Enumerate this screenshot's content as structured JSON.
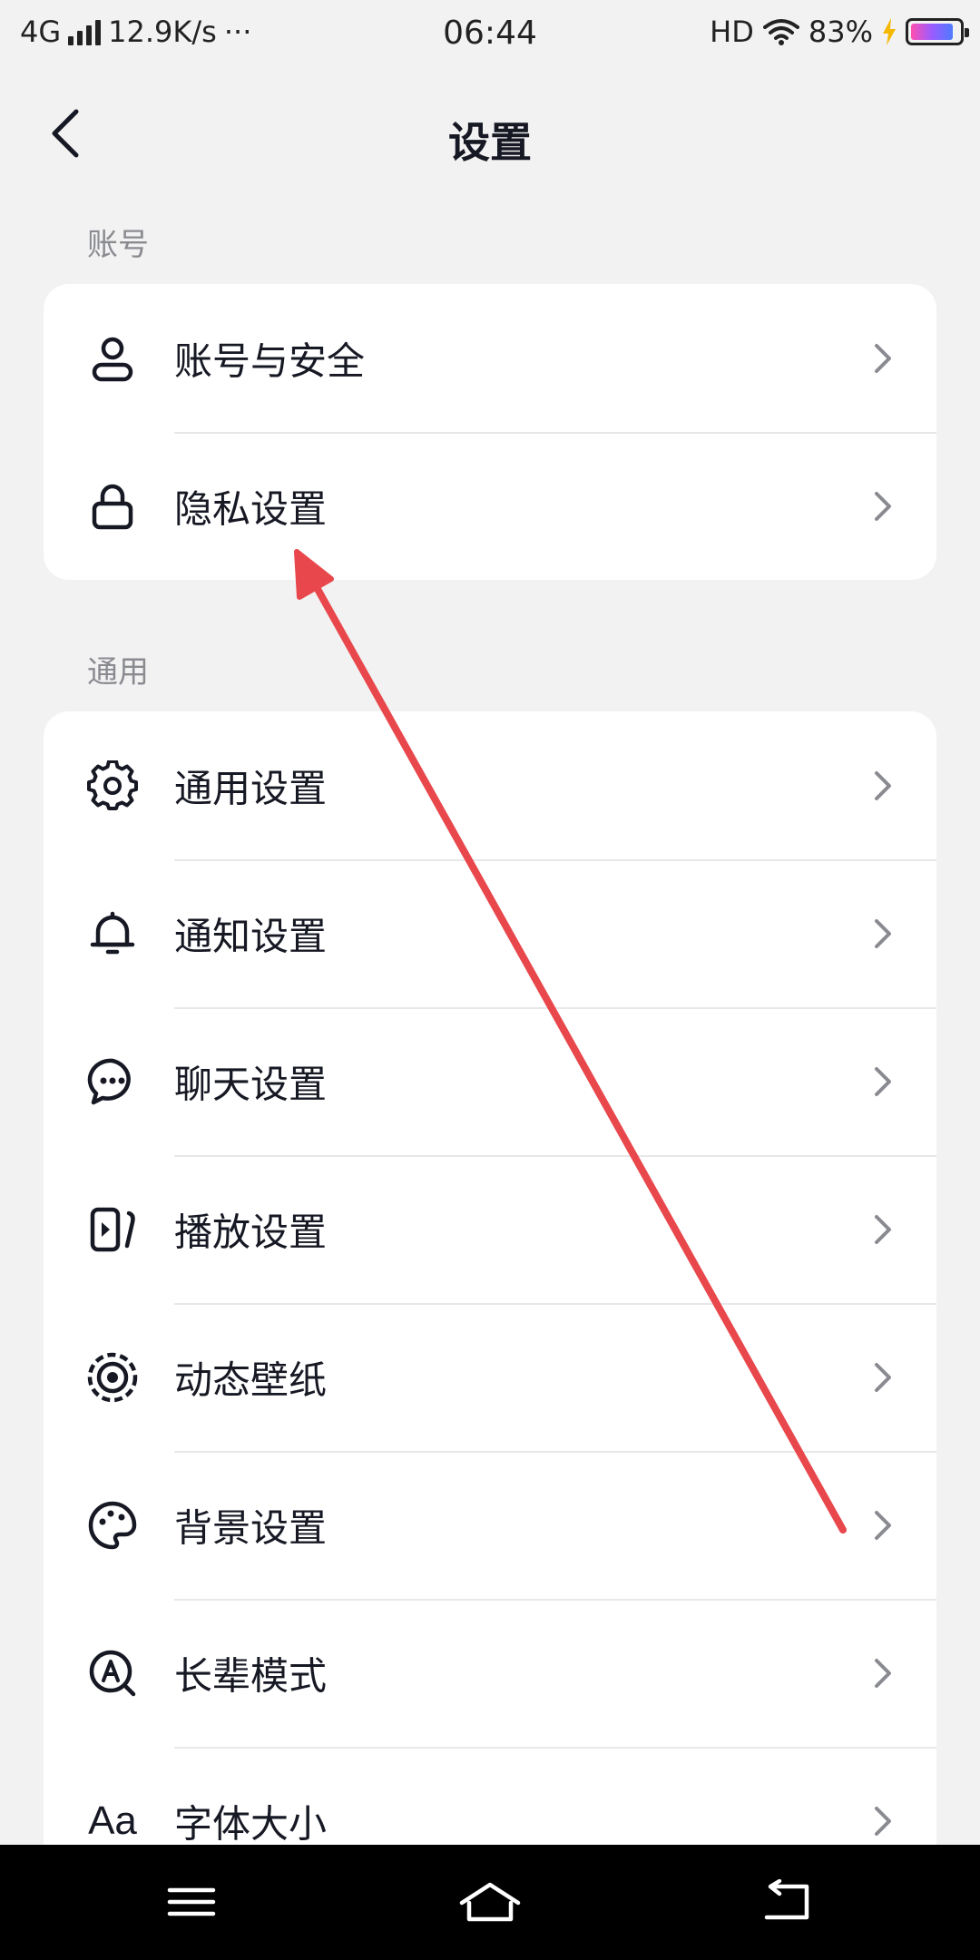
{
  "status_bar": {
    "network": "4G",
    "speed": "12.9K/s",
    "more": "···",
    "time": "06:44",
    "hd": "HD",
    "battery_percent": "83%"
  },
  "header": {
    "title": "设置"
  },
  "sections": {
    "account": {
      "label": "账号",
      "items": [
        {
          "label": "账号与安全",
          "icon": "user-icon"
        },
        {
          "label": "隐私设置",
          "icon": "lock-icon"
        }
      ]
    },
    "general": {
      "label": "通用",
      "items": [
        {
          "label": "通用设置",
          "icon": "gear-icon"
        },
        {
          "label": "通知设置",
          "icon": "bell-icon"
        },
        {
          "label": "聊天设置",
          "icon": "chat-bubble-icon"
        },
        {
          "label": "播放设置",
          "icon": "play-card-icon"
        },
        {
          "label": "动态壁纸",
          "icon": "live-wallpaper-icon"
        },
        {
          "label": "背景设置",
          "icon": "palette-icon"
        },
        {
          "label": "长辈模式",
          "icon": "elder-mode-icon"
        },
        {
          "label": "字体大小",
          "icon": "font-size-icon",
          "icon_text": "Aa"
        }
      ]
    }
  },
  "annotation": {
    "type": "arrow",
    "color": "#e8474c",
    "points_to": "隐私设置"
  },
  "colors": {
    "background": "#f2f2f2",
    "card": "#ffffff",
    "section_label": "#8a8b91",
    "text": "#161823",
    "chevron": "#8a8b91",
    "navbar": "#000000"
  }
}
